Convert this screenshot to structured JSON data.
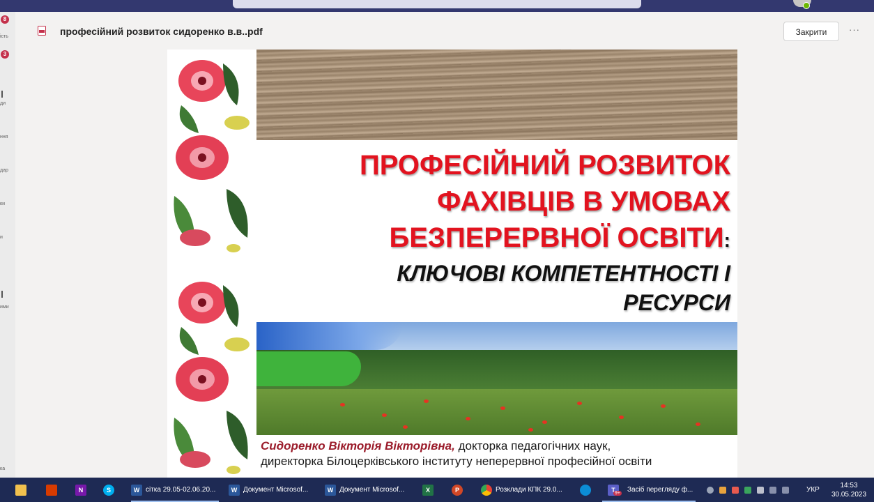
{
  "rail": {
    "badges": [
      "8",
      "3"
    ],
    "labels": [
      "ість",
      "ди",
      "ння",
      "дар",
      "ки",
      "и",
      "ими",
      "ка"
    ]
  },
  "viewer": {
    "file_title": "професійний розвиток сидоренко в.в..pdf",
    "close_label": "Закрити",
    "more_label": "···"
  },
  "slide": {
    "title_line1": "ПРОФЕСІЙНИЙ РОЗВИТОК",
    "title_line2": "ФАХІВЦІВ В УМОВАХ",
    "title_line3": "БЕЗПЕРЕРВНОЇ ОСВІТИ",
    "title_colon": ":",
    "subtitle_line1": "КЛЮЧОВІ КОМПЕТЕНТНОСТІ І",
    "subtitle_line2": "РЕСУРСИ",
    "author_name": "Сидоренко Вікторія Вікторівна,",
    "author_role1": " докторка педагогічних наук,",
    "author_role2": "директорка Білоцерківського інституту неперервної професійної освіти"
  },
  "taskbar": {
    "items": [
      {
        "label": "сітка 29.05-02.06.20..."
      },
      {
        "label": "Документ Microsof..."
      },
      {
        "label": "Документ Microsof..."
      },
      {
        "label": "Розклади КПК 29.0..."
      },
      {
        "label": "Засіб перегляду ф..."
      }
    ],
    "teams_badge": "9+",
    "language": "УКР",
    "time": "14:53",
    "date": "30.05.2023"
  },
  "colors": {
    "title_red": "#e2131f",
    "author_name": "#9b1c2b",
    "taskbar": "#1e2a54",
    "teams_bar": "#33386f"
  }
}
